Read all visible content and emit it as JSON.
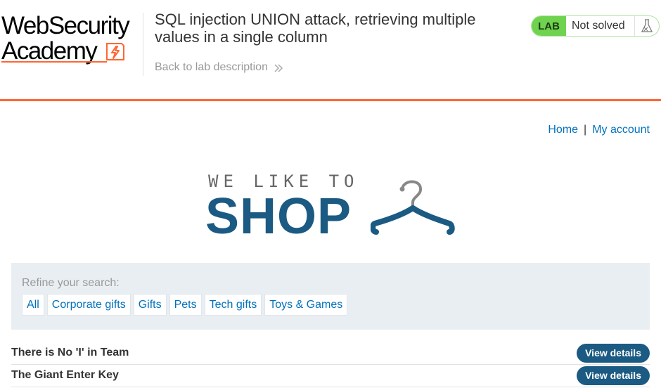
{
  "header": {
    "logo_line1": "WebSecurity",
    "logo_line2": "Academy",
    "lab_title": "SQL injection UNION attack, retrieving multiple values in a single column",
    "back_link": "Back to lab description",
    "lab_badge": "LAB",
    "lab_status": "Not solved"
  },
  "topnav": {
    "home": "Home",
    "separator": "|",
    "my_account": "My account"
  },
  "shop_logo": {
    "tagline": "WE LIKE TO",
    "word": "SHOP"
  },
  "filter": {
    "label": "Refine your search:",
    "categories": [
      "All",
      "Corporate gifts",
      "Gifts",
      "Pets",
      "Tech gifts",
      "Toys & Games"
    ]
  },
  "products": [
    {
      "name": "There is No 'I' in Team",
      "button": "View details"
    },
    {
      "name": "The Giant Enter Key",
      "button": "View details"
    }
  ],
  "colors": {
    "accent_orange": "#ff6633",
    "link_blue": "#0071bc",
    "shop_blue": "#1b5a82",
    "lab_green": "#70d34f"
  }
}
